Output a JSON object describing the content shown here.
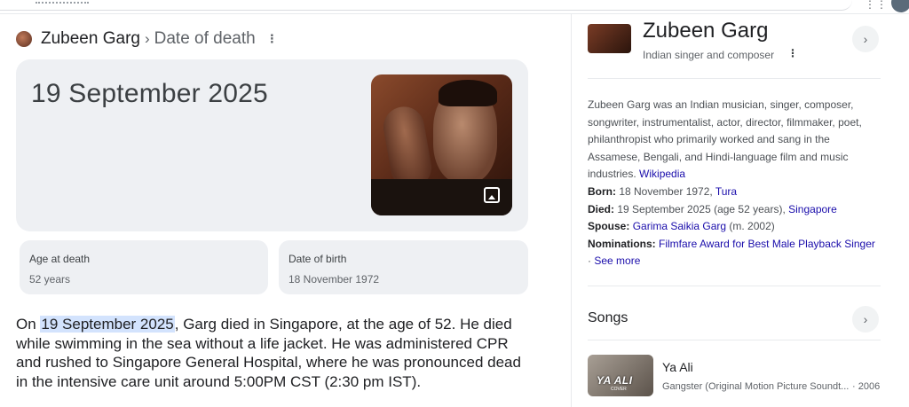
{
  "breadcrumb": {
    "entity": "Zubeen Garg",
    "separator": "›",
    "property": "Date of death",
    "more_icon": "more-vert-icon"
  },
  "answer": {
    "date": "19 September 2025",
    "image_icon": "image-icon"
  },
  "facts": [
    {
      "label": "Age at death",
      "value": "52 years"
    },
    {
      "label": "Date of birth",
      "value": "18 November 1972"
    }
  ],
  "description": {
    "prefix": "On ",
    "highlight": "19 September 2025",
    "rest": ", Garg died in Singapore, at the age of 52. He died while swimming in the sea without a life jacket. He was administered CPR and rushed to Singapore General Hospital, where he was pronounced dead in the intensive care unit around 5:00PM CST (2:30 pm IST)."
  },
  "knowledge_panel": {
    "title": "Zubeen Garg",
    "subtitle": "Indian singer and composer",
    "chevron": "›",
    "about": "Zubeen Garg was an Indian musician, singer, composer, songwriter, instrumentalist, actor, director, filmmaker, poet, philanthropist who primarily worked and sang in the Assamese, Bengali, and Hindi-language film and music industries.",
    "source_link": "Wikipedia",
    "born_label": "Born:",
    "born_value": " 18 November 1972, ",
    "born_link": "Tura",
    "died_label": "Died:",
    "died_value": " 19 September 2025 (age 52 years), ",
    "died_link": "Singapore",
    "spouse_label": "Spouse:",
    "spouse_link": "Garima Saikia Garg",
    "spouse_value": " (m. 2002)",
    "nominations_label": "Nominations:",
    "nominations_link": "Filmfare Award for Best Male Playback Singer",
    "dot": " · ",
    "see_more": "See more",
    "songs": {
      "heading": "Songs",
      "items": [
        {
          "title": "Ya Ali",
          "album": "Gangster (Original Motion Picture Soundt...",
          "year": "· 2006",
          "thumb_text": "YA ALI",
          "thumb_sub": "COVER"
        }
      ]
    }
  },
  "colors": {
    "link": "#1a0dab",
    "card_bg": "#eef0f3",
    "highlight": "#d3e3fd"
  }
}
